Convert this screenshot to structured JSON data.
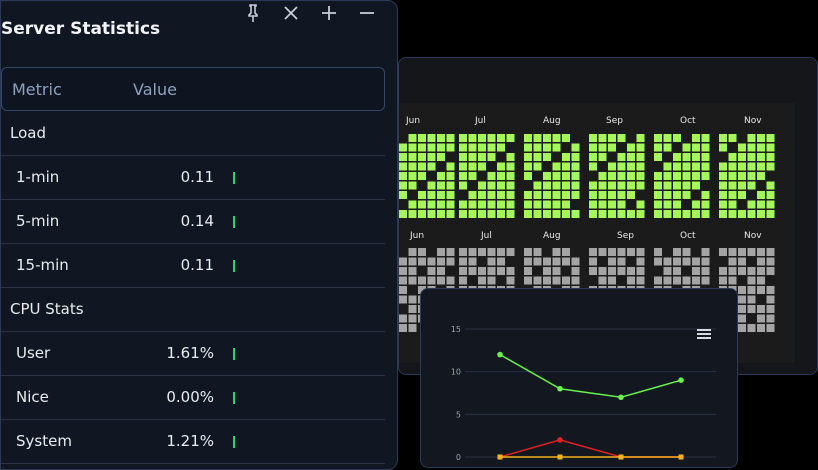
{
  "stats_panel": {
    "title": "Server Statistics",
    "actions": [
      "pin-icon",
      "close-icon",
      "plus-icon",
      "minimize-icon"
    ],
    "columns": [
      "Metric",
      "Value"
    ],
    "sections": [
      {
        "heading": "Load",
        "rows": [
          {
            "metric": "1-min",
            "value": "0.11"
          },
          {
            "metric": "5-min",
            "value": "0.14"
          },
          {
            "metric": "15-min",
            "value": "0.11"
          }
        ]
      },
      {
        "heading": "CPU Stats",
        "rows": [
          {
            "metric": "User",
            "value": "1.61%"
          },
          {
            "metric": "Nice",
            "value": "0.00%"
          },
          {
            "metric": "System",
            "value": "1.21%"
          }
        ]
      }
    ]
  },
  "heatmap_panel": {
    "months": [
      "Jun",
      "Jul",
      "Aug",
      "Sep",
      "Oct",
      "Nov"
    ],
    "colors": {
      "top": "#a6f75a",
      "bottom": "#a4a4a4",
      "bg": "#1b1b1b"
    }
  },
  "chart_panel": {
    "menu_icon": "hamburger-icon",
    "chart_data": {
      "type": "line",
      "y_ticks": [
        "15",
        "10",
        "5",
        "0"
      ],
      "ylim": [
        0,
        15
      ],
      "series": [
        {
          "values": [
            12,
            8,
            7,
            9
          ],
          "color": "#69f04b"
        },
        {
          "values": [
            0,
            2,
            0,
            0
          ],
          "color": "#e3221f"
        },
        {
          "values": [
            0,
            0,
            0,
            0
          ],
          "color": "#f3b41b"
        }
      ]
    }
  }
}
